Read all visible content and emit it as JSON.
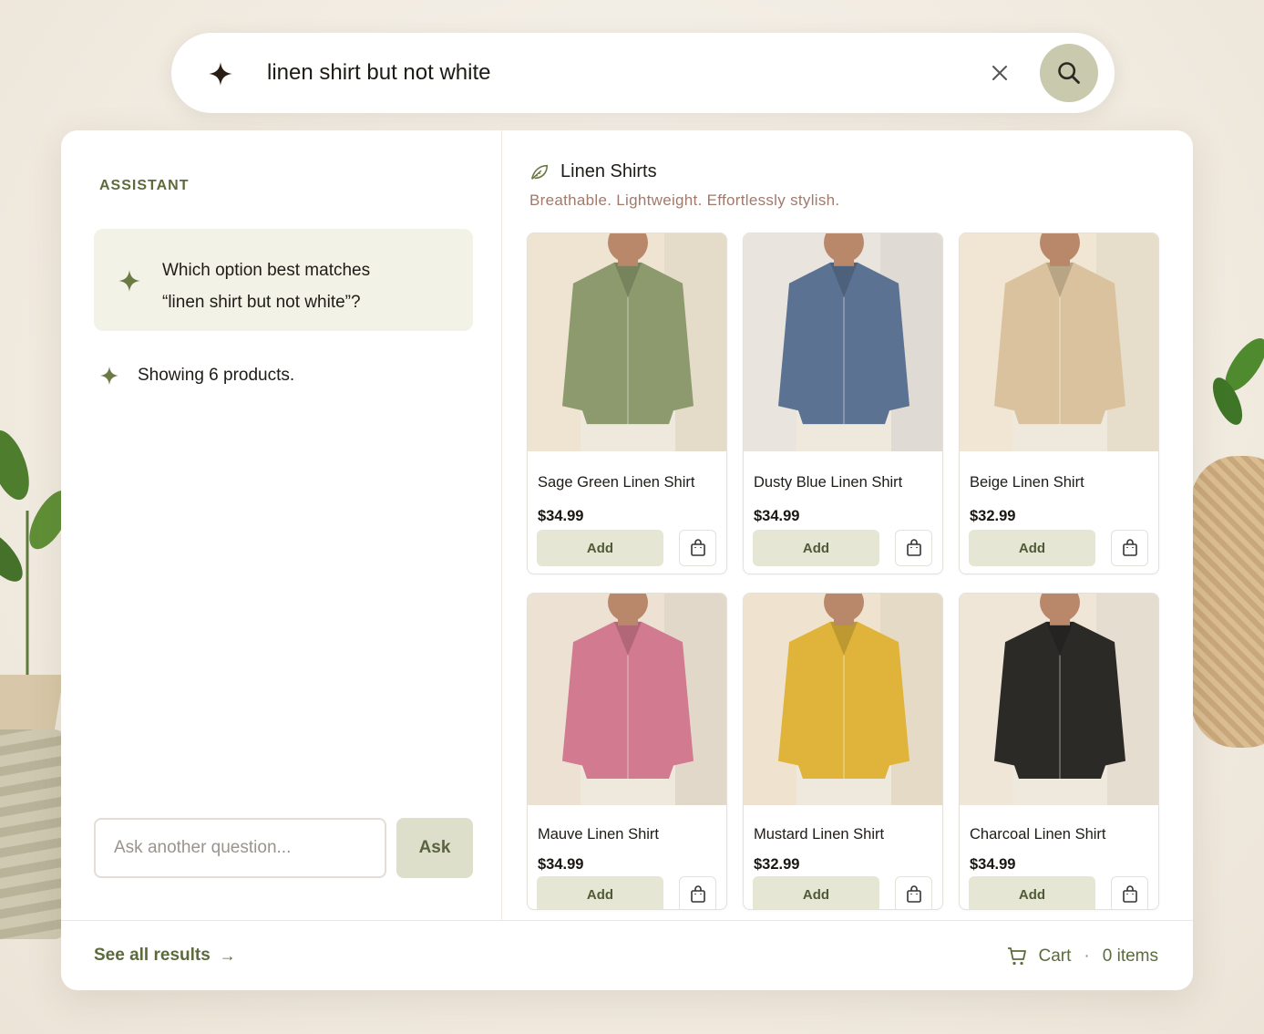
{
  "search": {
    "query": "linen shirt but not white",
    "spark_icon": "sparkle-icon",
    "clear_icon": "close-icon",
    "search_icon": "search-icon"
  },
  "assistant": {
    "title": "ASSISTANT",
    "question_line1": "Which option best matches",
    "question_line2": "“linen shirt but not white”?",
    "status": "Showing 6 products.",
    "input_placeholder": "Ask another question...",
    "ask_label": "Ask"
  },
  "category": {
    "title": "Linen Shirts",
    "subtitle": "Breathable. Lightweight. Effortlessly stylish.",
    "icon": "leaf-icon"
  },
  "products": [
    {
      "name": "Sage Green Linen Shirt",
      "price": "$34.99",
      "add_label": "Add",
      "color": "#8c9a6e",
      "bg": "#efe4d2"
    },
    {
      "name": "Dusty Blue Linen Shirt",
      "price": "$34.99",
      "add_label": "Add",
      "color": "#5b7293",
      "bg": "#e9e4dd"
    },
    {
      "name": "Beige Linen Shirt",
      "price": "$32.99",
      "add_label": "Add",
      "color": "#d9c29d",
      "bg": "#f1e6d4"
    },
    {
      "name": "Mauve Linen Shirt",
      "price": "$34.99",
      "add_label": "Add",
      "color": "#d27a8f",
      "bg": "#ece1d3"
    },
    {
      "name": "Mustard Linen Shirt",
      "price": "$32.99",
      "add_label": "Add",
      "color": "#e0b43a",
      "bg": "#efe3cf"
    },
    {
      "name": "Charcoal Linen Shirt",
      "price": "$34.99",
      "add_label": "Add",
      "color": "#2c2a27",
      "bg": "#efe6d8"
    }
  ],
  "footer": {
    "see_all": "See all results",
    "arrow": "→",
    "cart_label": "Cart",
    "separator": "·",
    "cart_count": "0 items"
  },
  "colors": {
    "accent": "#5b6b3b",
    "search_button": "#c8c9ad",
    "add_button": "#e5e6d4"
  }
}
